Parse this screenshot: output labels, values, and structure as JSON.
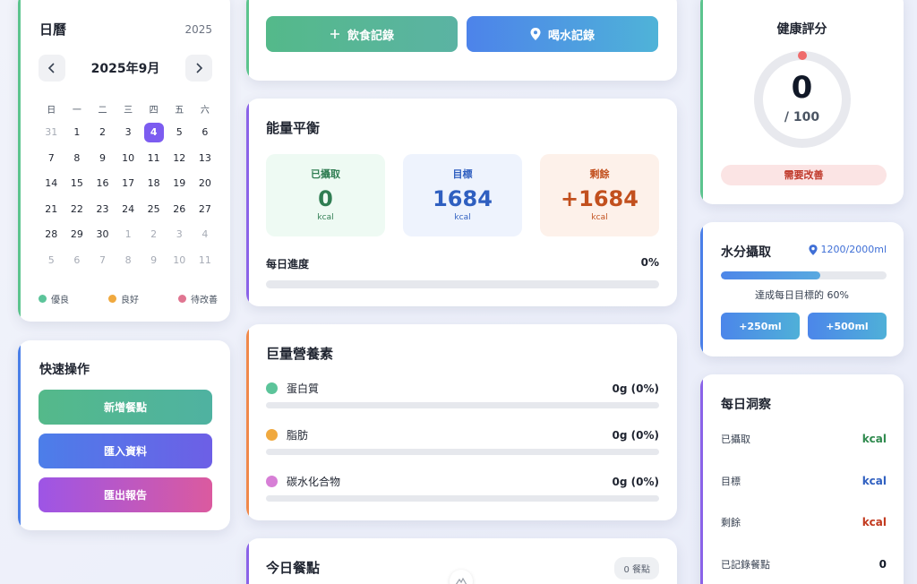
{
  "calendar": {
    "title": "日曆",
    "year": "2025",
    "month_label": "2025年9月",
    "weekdays": [
      "日",
      "一",
      "二",
      "三",
      "四",
      "五",
      "六"
    ],
    "days": [
      {
        "n": "31",
        "muted": true
      },
      {
        "n": "1"
      },
      {
        "n": "2"
      },
      {
        "n": "3"
      },
      {
        "n": "4",
        "today": true
      },
      {
        "n": "5"
      },
      {
        "n": "6"
      },
      {
        "n": "7"
      },
      {
        "n": "8"
      },
      {
        "n": "9"
      },
      {
        "n": "10"
      },
      {
        "n": "11"
      },
      {
        "n": "12"
      },
      {
        "n": "13"
      },
      {
        "n": "14"
      },
      {
        "n": "15"
      },
      {
        "n": "16"
      },
      {
        "n": "17"
      },
      {
        "n": "18"
      },
      {
        "n": "19"
      },
      {
        "n": "20"
      },
      {
        "n": "21"
      },
      {
        "n": "22"
      },
      {
        "n": "23"
      },
      {
        "n": "24"
      },
      {
        "n": "25"
      },
      {
        "n": "26"
      },
      {
        "n": "27"
      },
      {
        "n": "28"
      },
      {
        "n": "29"
      },
      {
        "n": "30"
      },
      {
        "n": "1",
        "muted": true
      },
      {
        "n": "2",
        "muted": true
      },
      {
        "n": "3",
        "muted": true
      },
      {
        "n": "4",
        "muted": true
      },
      {
        "n": "5",
        "muted": true
      },
      {
        "n": "6",
        "muted": true
      },
      {
        "n": "7",
        "muted": true
      },
      {
        "n": "8",
        "muted": true
      },
      {
        "n": "9",
        "muted": true
      },
      {
        "n": "10",
        "muted": true
      },
      {
        "n": "11",
        "muted": true
      }
    ],
    "legend": [
      {
        "label": "優良",
        "color": "#5cc49a"
      },
      {
        "label": "良好",
        "color": "#f0a93f"
      },
      {
        "label": "待改善",
        "color": "#e07591"
      }
    ]
  },
  "quick_actions": {
    "title": "快速操作",
    "add_meal": "新增餐點",
    "import_data": "匯入資料",
    "export_report": "匯出報告"
  },
  "top_actions": {
    "diet_record": "飲食記錄",
    "water_record": "喝水記錄",
    "diet_icon": "plus-icon",
    "water_icon": "location-pin-icon"
  },
  "energy": {
    "title": "能量平衡",
    "intake": {
      "label": "已攝取",
      "value": "0",
      "unit": "kcal"
    },
    "goal": {
      "label": "目標",
      "value": "1684",
      "unit": "kcal"
    },
    "remaining": {
      "label": "剩餘",
      "value": "+1684",
      "unit": "kcal"
    },
    "progress_label": "每日進度",
    "progress_value": "0%",
    "progress_fraction": 0
  },
  "macros": {
    "title": "巨量營養素",
    "items": [
      {
        "label": "蛋白質",
        "value": "0g (0%)",
        "color": "#5cc49a",
        "fraction": 0
      },
      {
        "label": "脂肪",
        "value": "0g (0%)",
        "color": "#f0a93f",
        "fraction": 0
      },
      {
        "label": "碳水化合物",
        "value": "0g (0%)",
        "color": "#d77fd6",
        "fraction": 0
      }
    ]
  },
  "meals": {
    "title": "今日餐點",
    "count_badge": "0 餐點"
  },
  "health": {
    "title": "健康評分",
    "score": "0",
    "max": "/ 100",
    "status": "需要改善",
    "score_fraction": 0
  },
  "water": {
    "title": "水分攝取",
    "amount": "1200/2000ml",
    "fraction": 0.6,
    "percent_text": "達成每日目標的 60%",
    "add_250": "+250ml",
    "add_500": "+500ml"
  },
  "insights": {
    "title": "每日洞察",
    "rows": [
      {
        "label": "已攝取",
        "value": "kcal",
        "color": "#2f8a4e"
      },
      {
        "label": "目標",
        "value": "kcal",
        "color": "#2f5fc0"
      },
      {
        "label": "剩餘",
        "value": "kcal",
        "color": "#c2391e"
      },
      {
        "label": "已記錄餐點",
        "value": "0",
        "color": "#111827"
      }
    ]
  },
  "colors": {
    "accent_purple": "#7c5cf0",
    "accent_green": "#5cc48e",
    "accent_blue": "#4a7fe8",
    "accent_orange": "#f0884a"
  }
}
